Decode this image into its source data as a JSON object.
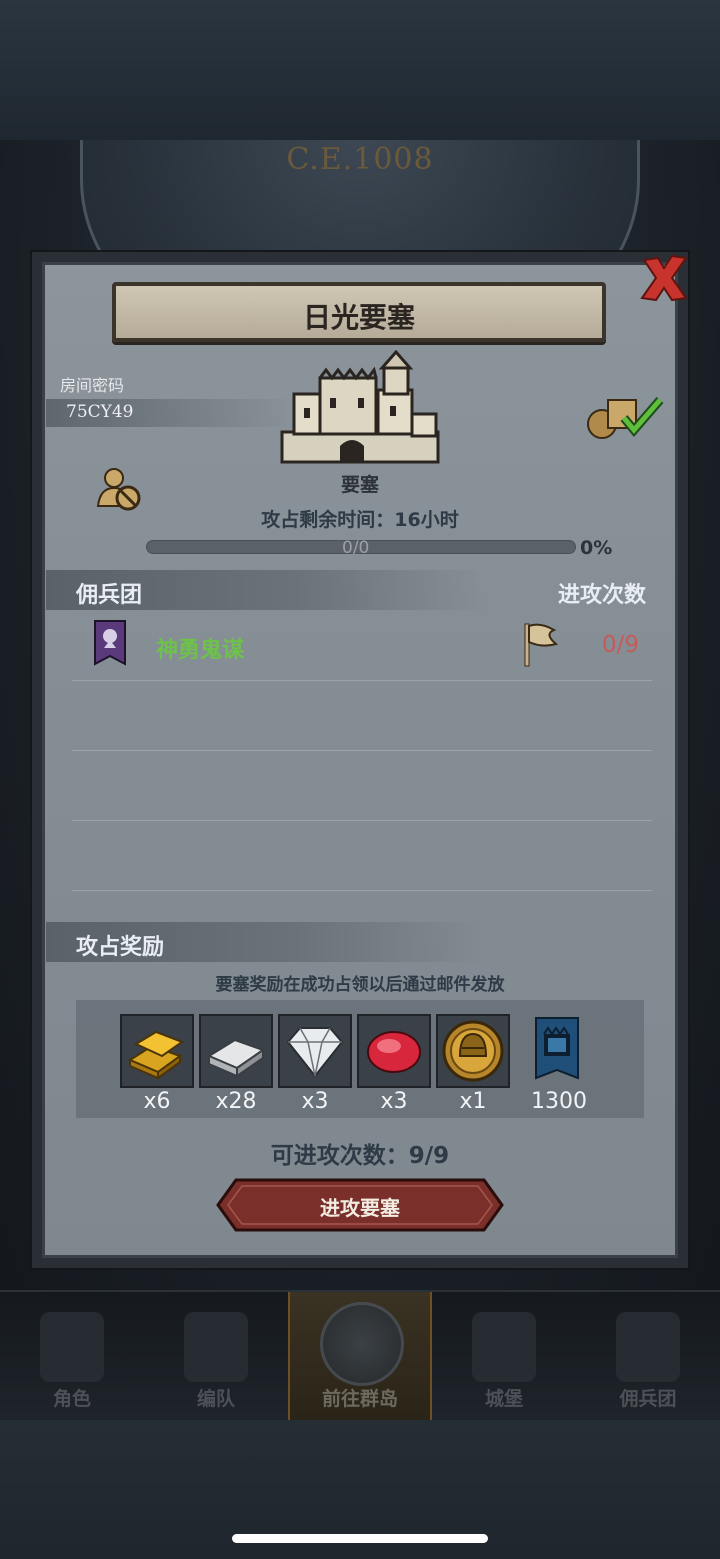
{
  "scene": {
    "year": "C.E.1008"
  },
  "dialog": {
    "title": "日光要塞",
    "room_label": "房间密码",
    "room_code": "75CY49",
    "fortress_label": "要塞",
    "remaining_time": "攻占剩余时间：16小时",
    "progress_text": "0/0",
    "progress_percent": "0%",
    "progress_value": 0,
    "mercenary_header": "佣兵团",
    "attack_header": "进攻次数",
    "mercenary": {
      "name": "神勇鬼谋",
      "attacks": "0/9"
    },
    "reward_header": "攻占奖励",
    "reward_note": "要塞奖励在成功占领以后通过邮件发放",
    "rewards": [
      {
        "icon": "gold-bar-icon",
        "count": "x6"
      },
      {
        "icon": "silver-bar-icon",
        "count": "x28"
      },
      {
        "icon": "diamond-icon",
        "count": "x3"
      },
      {
        "icon": "ruby-icon",
        "count": "x3"
      },
      {
        "icon": "gold-helmet-coin-icon",
        "count": "x1"
      },
      {
        "icon": "fortress-banner-icon",
        "count": "1300"
      }
    ],
    "attempts_left": "可进攻次数：9/9",
    "attack_button": "进攻要塞"
  },
  "nav": {
    "items": [
      {
        "label": "角色",
        "icon": "knight-icon"
      },
      {
        "label": "编队",
        "icon": "formation-icon"
      },
      {
        "label": "前往群岛",
        "icon": "compass-icon"
      },
      {
        "label": "城堡",
        "icon": "castle-icon"
      },
      {
        "label": "佣兵团",
        "icon": "ship-icon"
      }
    ]
  },
  "colors": {
    "merc_name": "#6ec24a",
    "attack_count": "#c85a5a",
    "attack_button": "#7a2f2b",
    "close_x": "#c8332d"
  }
}
